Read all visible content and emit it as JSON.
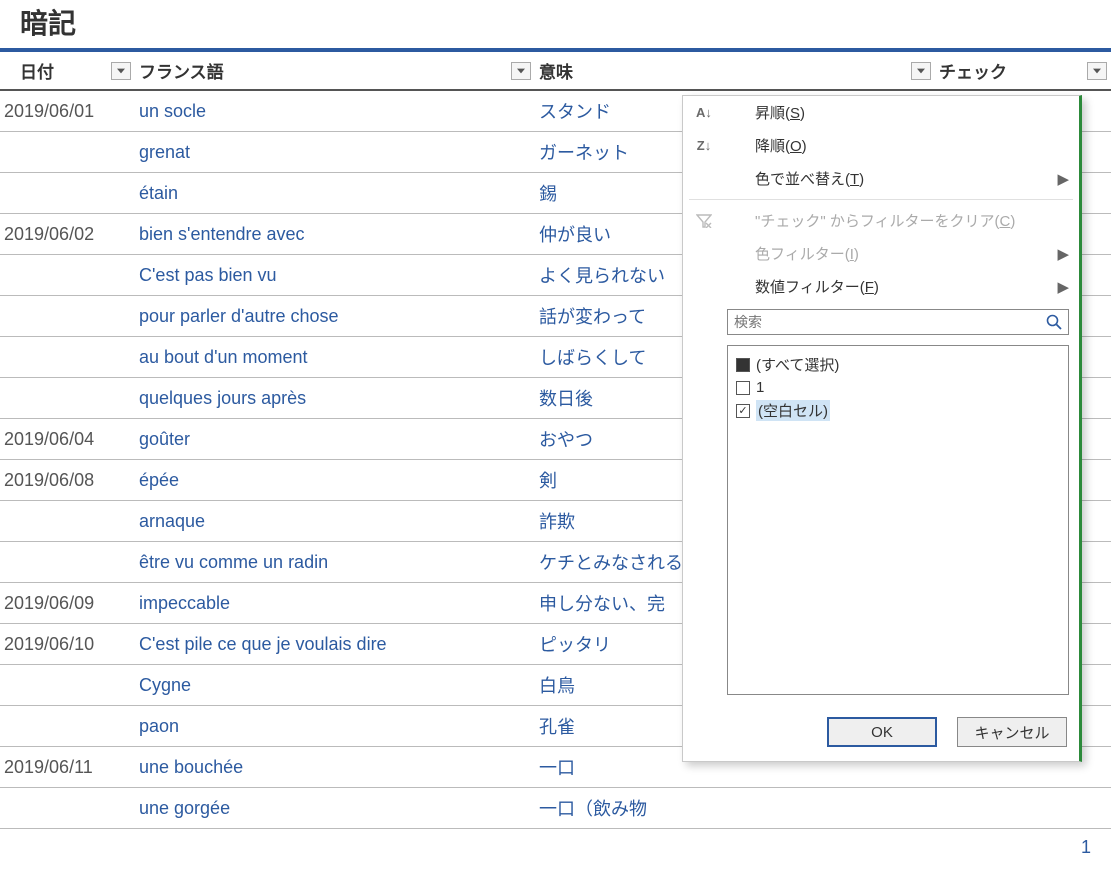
{
  "page_title": "暗記",
  "columns": {
    "date": "日付",
    "french": "フランス語",
    "meaning": "意味",
    "check": "チェック"
  },
  "rows": [
    {
      "date": "2019/06/01",
      "fr": "un socle",
      "mean": "スタンド"
    },
    {
      "date": "",
      "fr": "grenat",
      "mean": "ガーネット"
    },
    {
      "date": "",
      "fr": "étain",
      "mean": "錫"
    },
    {
      "date": "2019/06/02",
      "fr": "bien s'entendre avec",
      "mean": "仲が良い"
    },
    {
      "date": "",
      "fr": "C'est pas bien vu",
      "mean": "よく見られない"
    },
    {
      "date": "",
      "fr": "pour parler d'autre chose",
      "mean": "話が変わって"
    },
    {
      "date": "",
      "fr": "au bout d'un moment",
      "mean": "しばらくして"
    },
    {
      "date": "",
      "fr": "quelques jours après",
      "mean": "数日後"
    },
    {
      "date": "2019/06/04",
      "fr": "goûter",
      "mean": "おやつ"
    },
    {
      "date": "2019/06/08",
      "fr": "épée",
      "mean": "剣"
    },
    {
      "date": "",
      "fr": "arnaque",
      "mean": "詐欺"
    },
    {
      "date": "",
      "fr": "être vu comme un radin",
      "mean": "ケチとみなされる"
    },
    {
      "date": "2019/06/09",
      "fr": "impeccable",
      "mean": "申し分ない、完"
    },
    {
      "date": "2019/06/10",
      "fr": "C'est pile ce que je voulais dire",
      "mean": "ピッタリ"
    },
    {
      "date": "",
      "fr": "Cygne",
      "mean": "白鳥"
    },
    {
      "date": "",
      "fr": "paon",
      "mean": "孔雀"
    },
    {
      "date": "2019/06/11",
      "fr": "une bouchée",
      "mean": "一口"
    },
    {
      "date": "",
      "fr": "une gorgée",
      "mean": "一口（飲み物"
    }
  ],
  "pager_current": "1",
  "filter_menu": {
    "sort_asc": {
      "prefix": "昇順(",
      "mn": "S",
      "suffix": ")"
    },
    "sort_desc": {
      "prefix": "降順(",
      "mn": "O",
      "suffix": ")"
    },
    "sort_color": {
      "prefix": "色で並べ替え(",
      "mn": "T",
      "suffix": ")"
    },
    "clear_filter": {
      "prefix": "\"チェック\" からフィルターをクリア(",
      "mn": "C",
      "suffix": ")"
    },
    "color_filter": {
      "prefix": "色フィルター(",
      "mn": "I",
      "suffix": ")"
    },
    "number_filter": {
      "prefix": "数値フィルター(",
      "mn": "F",
      "suffix": ")"
    },
    "search_placeholder": "検索",
    "items": [
      {
        "label": "(すべて選択)",
        "state": "mixed"
      },
      {
        "label": "1",
        "state": "off"
      },
      {
        "label": "(空白セル)",
        "state": "on",
        "highlight": true
      }
    ],
    "ok": "OK",
    "cancel": "キャンセル"
  }
}
